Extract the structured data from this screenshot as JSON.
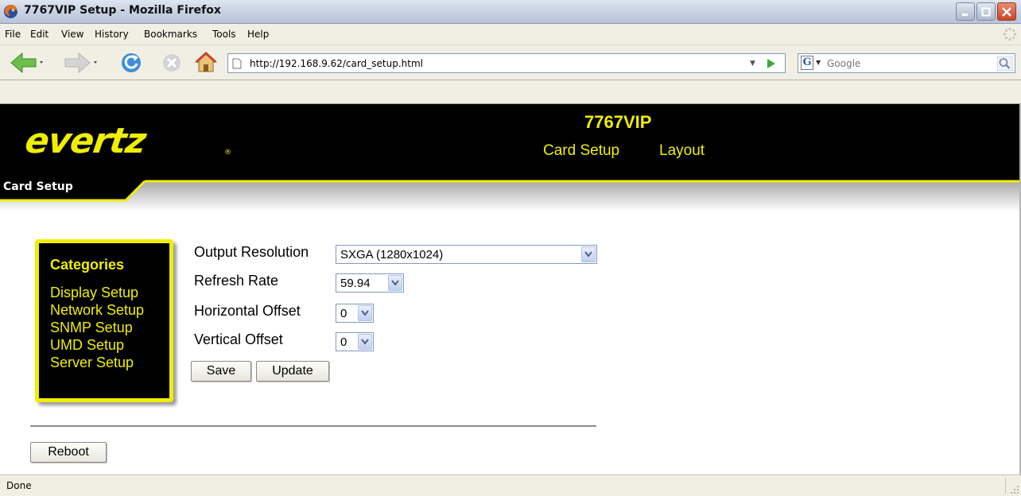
{
  "window": {
    "title": "7767VIP Setup - Mozilla Firefox"
  },
  "menu": {
    "items": [
      "File",
      "Edit",
      "View",
      "History",
      "Bookmarks",
      "Tools",
      "Help"
    ]
  },
  "navbar": {
    "url": "http://192.168.9.62/card_setup.html",
    "search_placeholder": "Google",
    "icons": [
      "back-arrow-icon",
      "forward-arrow-icon",
      "reload-icon",
      "stop-icon",
      "home-icon"
    ]
  },
  "header": {
    "logo": "evertz",
    "reg_mark": "®",
    "model": "7767VIP",
    "nav": [
      "Card Setup",
      "Layout"
    ],
    "section_tab": "Card Setup",
    "brand_color": "#f0ee00"
  },
  "categories": {
    "title": "Categories",
    "links": [
      "Display Setup",
      "Network Setup",
      "SNMP Setup",
      "UMD Setup",
      "Server Setup"
    ]
  },
  "form": {
    "output_resolution": {
      "label": "Output Resolution",
      "value": "SXGA (1280x1024)"
    },
    "refresh_rate": {
      "label": "Refresh Rate",
      "value": "59.94"
    },
    "horizontal_offset": {
      "label": "Horizontal Offset",
      "value": "0"
    },
    "vertical_offset": {
      "label": "Vertical Offset",
      "value": "0"
    },
    "save_label": "Save",
    "update_label": "Update",
    "reboot_label": "Reboot"
  },
  "status": {
    "text": "Done"
  }
}
